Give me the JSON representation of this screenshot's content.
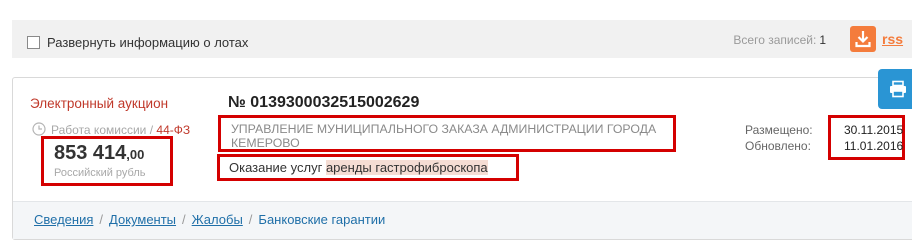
{
  "toolbar": {
    "expand_label": "Развернуть информацию о лотах",
    "total_label": "Всего записей:",
    "total_value": "1",
    "rss_label": "rss"
  },
  "record": {
    "procedure_type": "Электронный аукцион",
    "stage": "Работа комиссии",
    "stage_sep": "/",
    "law": "44-ФЗ",
    "price_main": "853 414",
    "price_kop": ",00",
    "currency": "Российский рубль",
    "number": "№ 0139300032515002629",
    "customer": "УПРАВЛЕНИЕ МУНИЦИПАЛЬНОГО ЗАКАЗА АДМИНИСТРАЦИИ ГОРОДА КЕМЕРОВО",
    "subject_plain": "Оказание услуг",
    "subject_highlight": "аренды гастрофиброскопа",
    "placed_label": "Размещено:",
    "placed_date": "30.11.2015",
    "updated_label": "Обновлено:",
    "updated_date": "11.01.2016"
  },
  "tabs": [
    "Сведения",
    "Документы",
    "Жалобы",
    "Банковские гарантии"
  ],
  "colors": {
    "accent_orange": "#f47c3c",
    "accent_blue": "#2a95d4",
    "link": "#1f6fa8",
    "procedure_red": "#c0392b",
    "highlight_box": "#d40000"
  },
  "icons": {
    "download": "download-icon",
    "clock": "clock-icon",
    "side": "printer-icon"
  }
}
